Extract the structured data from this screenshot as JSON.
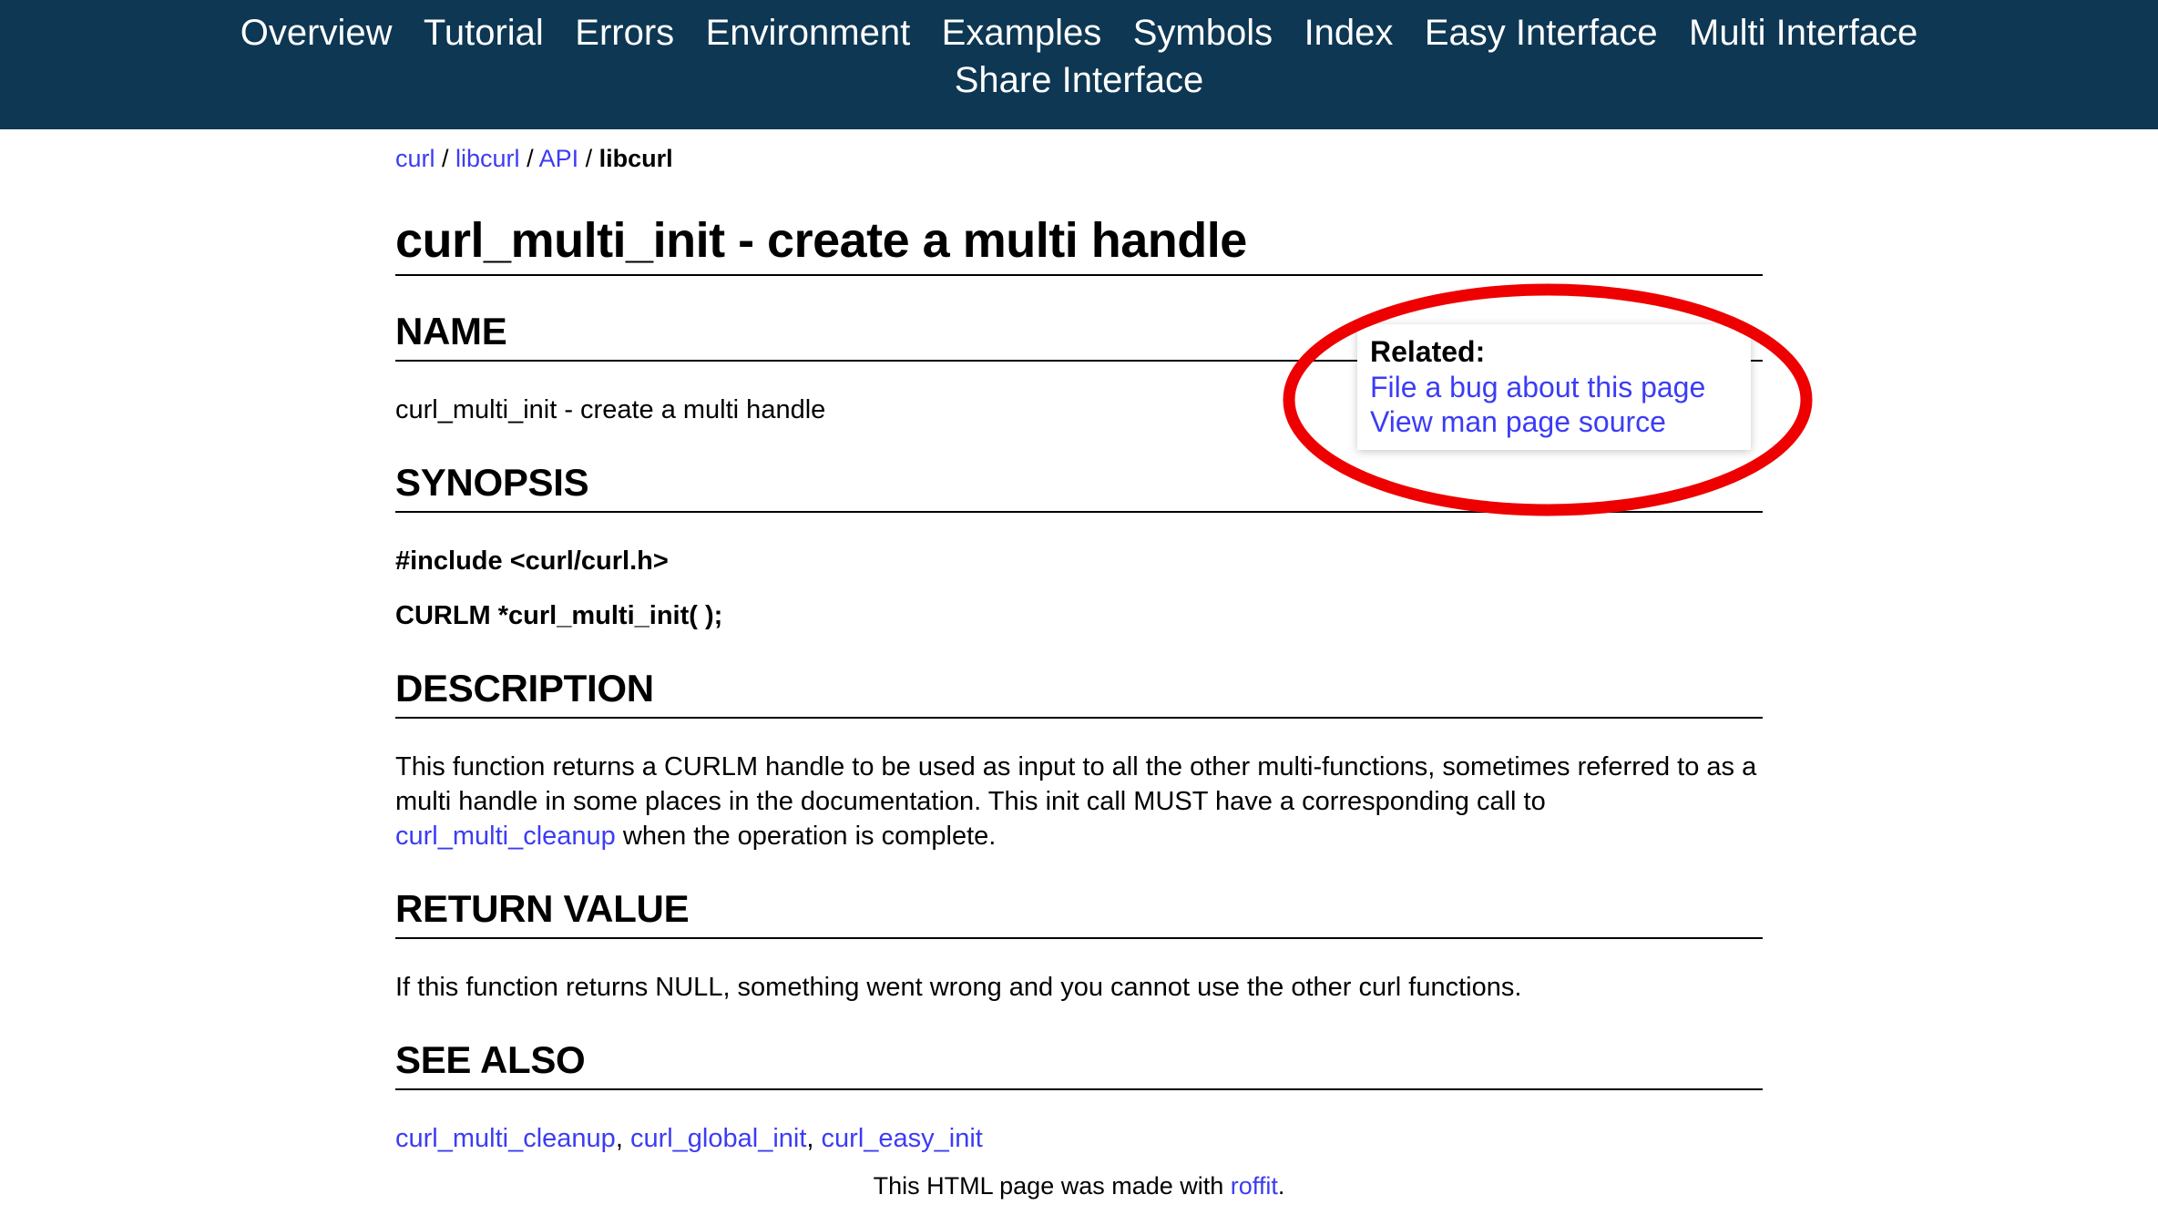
{
  "colors": {
    "nav_background": "#0d3753",
    "nav_text": "#ffffff",
    "link": "#3c3cf5",
    "text": "#000000",
    "annotation": "#ee0000",
    "page_background": "#ffffff"
  },
  "topnav": {
    "row1": [
      {
        "label": "Overview"
      },
      {
        "label": "Tutorial"
      },
      {
        "label": "Errors"
      },
      {
        "label": "Environment"
      },
      {
        "label": "Examples"
      },
      {
        "label": "Symbols"
      },
      {
        "label": "Index"
      },
      {
        "label": "Easy Interface"
      },
      {
        "label": "Multi Interface"
      }
    ],
    "row2": [
      {
        "label": "Share Interface"
      }
    ]
  },
  "breadcrumb": {
    "items": [
      {
        "label": "curl",
        "link": true
      },
      {
        "label": "libcurl",
        "link": true
      },
      {
        "label": "API",
        "link": true
      },
      {
        "label": "libcurl",
        "link": false
      }
    ],
    "separator": "/"
  },
  "page": {
    "title": "curl_multi_init - create a multi handle"
  },
  "related": {
    "title": "Related:",
    "links": [
      "File a bug about this page",
      "View man page source"
    ]
  },
  "sections": {
    "name": {
      "heading": "NAME",
      "body": "curl_multi_init - create a multi handle"
    },
    "synopsis": {
      "heading": "SYNOPSIS",
      "line1": "#include <curl/curl.h>",
      "line2": "CURLM *curl_multi_init( );"
    },
    "description": {
      "heading": "DESCRIPTION",
      "part1": "This function returns a CURLM handle to be used as input to all the other multi-functions, sometimes referred to as a multi handle in some places in the documentation. This init call MUST have a corresponding call to ",
      "link": "curl_multi_cleanup",
      "part2": " when the operation is complete."
    },
    "return_value": {
      "heading": "RETURN VALUE",
      "body": "If this function returns NULL, something went wrong and you cannot use the other curl functions."
    },
    "see_also": {
      "heading": "SEE ALSO",
      "links": [
        "curl_multi_cleanup",
        "curl_global_init",
        "curl_easy_init"
      ],
      "separator": ", "
    }
  },
  "footer": {
    "text_before": "This HTML page was made with ",
    "link": "roffit",
    "text_after": "."
  }
}
